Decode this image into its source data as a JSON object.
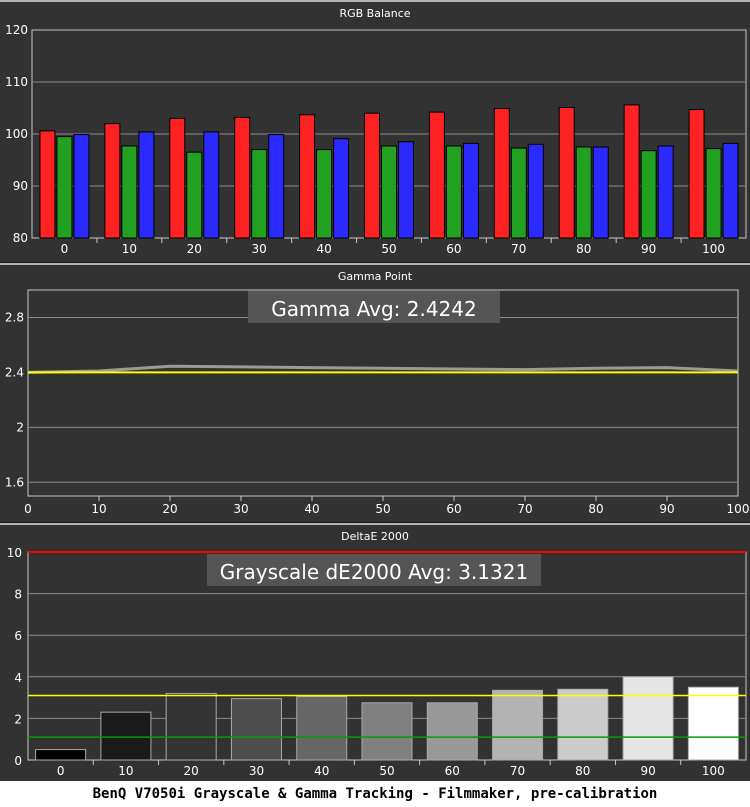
{
  "caption": "BenQ V7050i Grayscale & Gamma Tracking - Filmmaker, pre-calibration",
  "colors": {
    "background": "#323232",
    "panel_border": "#b4b4b4",
    "red": "#ff2222",
    "green": "#22a022",
    "blue": "#2a2aff",
    "gamma_target": "#ffff00",
    "gamma_measured": "#9a9a9a",
    "threshold_red": "#ff0000",
    "threshold_yellow": "#ffff00",
    "threshold_green": "#00a000"
  },
  "chart_data": [
    {
      "type": "bar",
      "title": "RGB Balance",
      "categories": [
        "0",
        "10",
        "20",
        "30",
        "40",
        "50",
        "60",
        "70",
        "80",
        "90",
        "100"
      ],
      "ylim": [
        80,
        120
      ],
      "yticks": [
        80,
        90,
        100,
        110,
        120
      ],
      "series": [
        {
          "color": "red",
          "values": [
            100.6,
            102.0,
            103.0,
            103.2,
            103.7,
            104.0,
            104.2,
            104.9,
            105.1,
            105.6,
            104.7
          ]
        },
        {
          "color": "green",
          "values": [
            99.5,
            97.7,
            96.5,
            97.0,
            97.0,
            97.7,
            97.7,
            97.3,
            97.5,
            96.8,
            97.2
          ]
        },
        {
          "color": "blue",
          "values": [
            99.9,
            100.4,
            100.4,
            99.9,
            99.1,
            98.5,
            98.2,
            98.0,
            97.5,
            97.7,
            98.2
          ]
        }
      ]
    },
    {
      "type": "line",
      "title": "Gamma Point",
      "annotation": "Gamma Avg: 2.4242",
      "x": [
        0,
        10,
        20,
        30,
        40,
        50,
        60,
        70,
        80,
        90,
        100
      ],
      "xlim": [
        0,
        100
      ],
      "ylim": [
        1.5,
        3.0
      ],
      "yticks": [
        1.6,
        2,
        2.4,
        2.8
      ],
      "ytick_labels": [
        "1.6",
        "2",
        "2.4",
        "2.8"
      ],
      "series": [
        {
          "role": "target",
          "values": [
            2.4,
            2.4,
            2.4,
            2.4,
            2.4,
            2.4,
            2.4,
            2.4,
            2.4,
            2.4,
            2.4
          ]
        },
        {
          "role": "measured",
          "values": [
            2.4,
            2.41,
            2.445,
            2.44,
            2.435,
            2.43,
            2.425,
            2.42,
            2.43,
            2.435,
            2.41
          ]
        }
      ]
    },
    {
      "type": "bar",
      "title": "DeltaE 2000",
      "annotation": "Grayscale dE2000 Avg: 3.1321",
      "categories": [
        "0",
        "10",
        "20",
        "30",
        "40",
        "50",
        "60",
        "70",
        "80",
        "90",
        "100"
      ],
      "values": [
        0.5,
        2.3,
        3.2,
        2.95,
        3.05,
        2.75,
        2.75,
        3.35,
        3.4,
        4.0,
        3.5
      ],
      "bar_gray_levels": [
        0,
        10,
        20,
        30,
        40,
        50,
        60,
        70,
        80,
        90,
        100
      ],
      "ylim": [
        0,
        10
      ],
      "yticks": [
        0,
        2,
        4,
        6,
        8,
        10
      ],
      "thresholds": [
        10,
        3.1,
        1.1
      ]
    }
  ]
}
